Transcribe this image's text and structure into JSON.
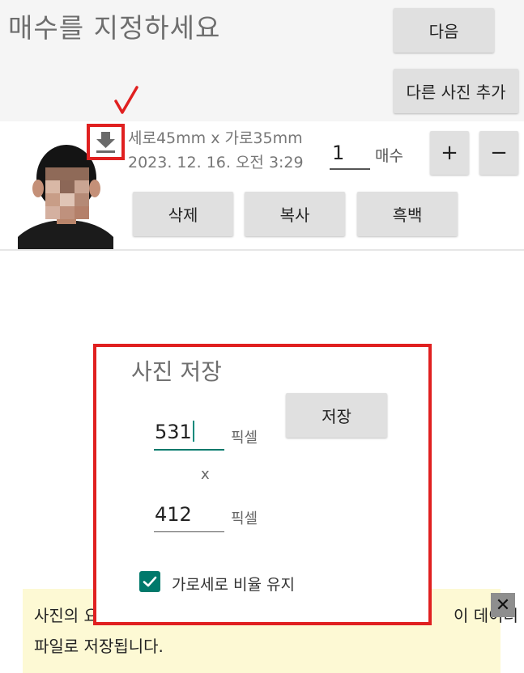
{
  "header": {
    "title": "매수를 지정하세요",
    "next_label": "다음",
    "add_photo_label": "다른 사진 추가"
  },
  "photo_item": {
    "size_text": "세로45mm x 가로35mm",
    "date_text": "2023. 12. 16. 오전 3:29",
    "count_value": "1",
    "count_unit": "매수",
    "plus_label": "+",
    "minus_label": "−",
    "delete_label": "삭제",
    "copy_label": "복사",
    "bw_label": "흑백"
  },
  "save_dialog": {
    "title": "사진 저장",
    "save_label": "저장",
    "width_value": "531",
    "height_value": "412",
    "unit_label": "픽셀",
    "times_label": "x",
    "keep_ratio_label": "가로세로 비율 유지",
    "keep_ratio_checked": true
  },
  "toast": {
    "line1_left": "사진의 요",
    "line1_right": "이 데이터",
    "line2": "파일로 저장됩니다.",
    "close_label": "✕"
  },
  "colors": {
    "annotation_red": "#e02020",
    "accent_teal": "#00796b",
    "toast_bg": "#fdf9d4"
  }
}
